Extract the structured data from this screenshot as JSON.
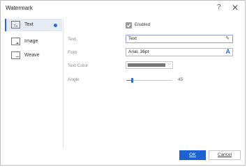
{
  "window": {
    "title": "Watermark",
    "help": "?",
    "close": "✕"
  },
  "sidebar": {
    "items": [
      {
        "label": "Text",
        "selected": true
      },
      {
        "label": "Image",
        "selected": false
      },
      {
        "label": "Weave",
        "selected": false
      }
    ]
  },
  "form": {
    "enabled_label": "Enabled",
    "enabled_checked": true,
    "text": {
      "label": "Text",
      "value": "Text"
    },
    "font": {
      "label": "Font",
      "value": "Arial, 36pt"
    },
    "text_color": {
      "label": "Text Color",
      "color": "#777777"
    },
    "angle": {
      "label": "Angle",
      "value": "45",
      "fraction": 0.125
    }
  },
  "buttons": {
    "ok": "OK",
    "cancel": "Cancel"
  },
  "colors": {
    "accent": "#2b6bd6",
    "ok_bg": "#1e62d0"
  }
}
